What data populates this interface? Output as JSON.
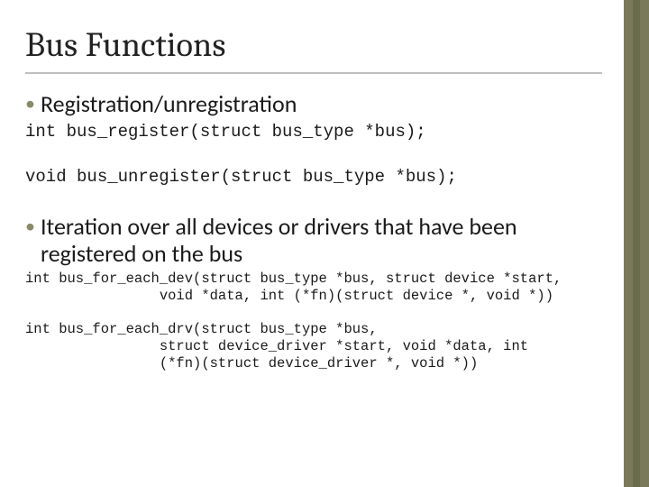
{
  "title": "Bus Functions",
  "bullets": {
    "b1": "Registration/unregistration",
    "b2": "Iteration over all devices or drivers that have been registered on the bus"
  },
  "code": {
    "reg": "int bus_register(struct bus_type *bus);",
    "unreg": "void bus_unregister(struct bus_type *bus);",
    "each_dev": "int bus_for_each_dev(struct bus_type *bus, struct device *start,\n                void *data, int (*fn)(struct device *, void *))",
    "each_drv": "int bus_for_each_drv(struct bus_type *bus,\n                struct device_driver *start, void *data, int\n                (*fn)(struct device_driver *, void *))"
  }
}
